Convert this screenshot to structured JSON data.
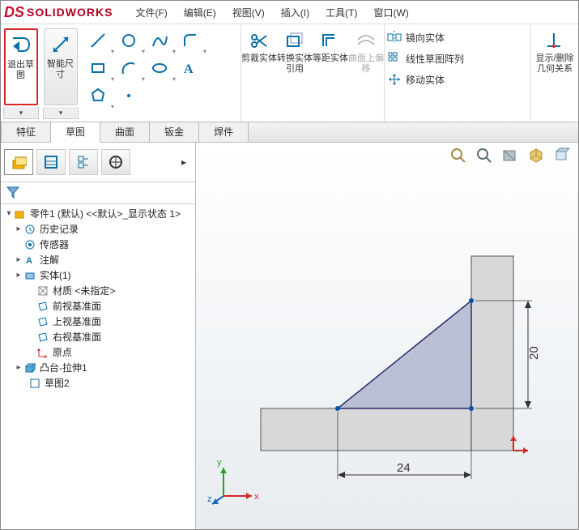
{
  "brand": {
    "ds": "DS",
    "name": "SOLIDWORKS",
    "color": "#c8102e"
  },
  "menu": {
    "file": "文件(F)",
    "edit": "编辑(E)",
    "view": "视图(V)",
    "insert": "插入(I)",
    "tools": "工具(T)",
    "window": "窗口(W)"
  },
  "ribbon": {
    "exit_sketch": "退出草图",
    "smart_dim": "智能尺寸",
    "trim": "剪裁实体",
    "convert": "转换实体引用",
    "offset": "等距实体",
    "offset_surface": "曲面上偏移",
    "mirror": "镜向实体",
    "linear_pattern": "线性草图阵列",
    "move": "移动实体",
    "display_delete_relations": "显示/删除几何关系"
  },
  "tabs": {
    "feature": "特征",
    "sketch": "草图",
    "surface": "曲面",
    "sheetmetal": "钣金",
    "weldment": "焊件"
  },
  "tree": {
    "root": "零件1 (默认) <<默认>_显示状态 1>",
    "history": "历史记录",
    "sensors": "传感器",
    "annotations": "注解",
    "solid_bodies": "实体(1)",
    "material": "材质 <未指定>",
    "front_plane": "前视基准面",
    "top_plane": "上视基准面",
    "right_plane": "右视基准面",
    "origin": "原点",
    "boss_extrude": "凸台-拉伸1",
    "sketch2": "草图2"
  },
  "dims": {
    "vertical": "20",
    "horizontal": "24"
  },
  "axes": {
    "x": "x",
    "y": "y",
    "z": "z"
  }
}
